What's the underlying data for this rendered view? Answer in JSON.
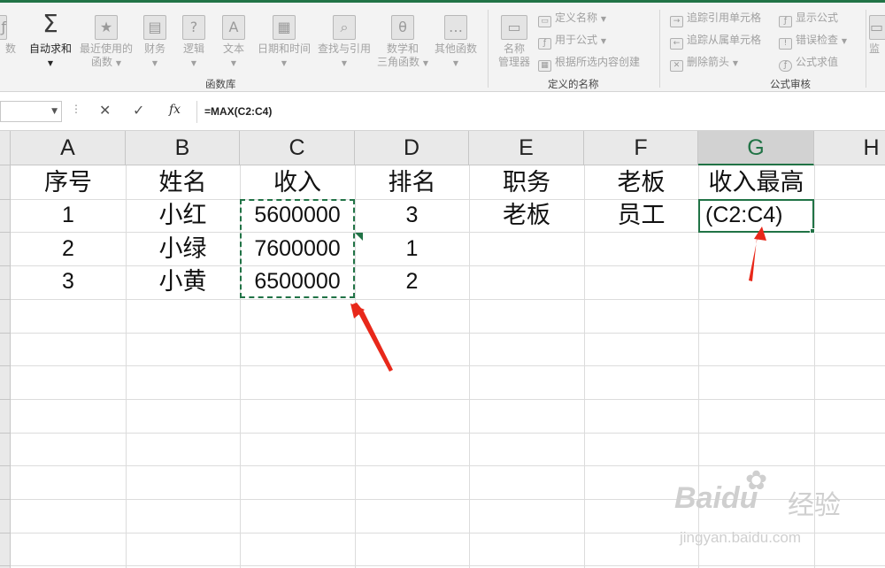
{
  "ribbon": {
    "partial_left_label": "数",
    "buttons": [
      {
        "label": "自动求和",
        "sub": "",
        "icon": "autosum-icon",
        "glyph": "Σ"
      },
      {
        "label": "最近使用的",
        "sub": "函数",
        "icon": "recent-functions-icon",
        "glyph": "★"
      },
      {
        "label": "财务",
        "sub": "",
        "icon": "financial-icon",
        "glyph": "▤"
      },
      {
        "label": "逻辑",
        "sub": "",
        "icon": "logical-icon",
        "glyph": "?"
      },
      {
        "label": "文本",
        "sub": "",
        "icon": "text-function-icon",
        "glyph": "A"
      },
      {
        "label": "日期和时间",
        "sub": "",
        "icon": "date-time-icon",
        "glyph": "▦"
      },
      {
        "label": "查找与引用",
        "sub": "",
        "icon": "lookup-reference-icon",
        "glyph": "⌕"
      },
      {
        "label": "数学和",
        "sub": "三角函数",
        "icon": "math-trig-icon",
        "glyph": "θ"
      },
      {
        "label": "其他函数",
        "sub": "",
        "icon": "more-functions-icon",
        "glyph": "…"
      }
    ],
    "group_function_library": "函数库",
    "name_manager": {
      "label": "名称",
      "sub": "管理器"
    },
    "defined_names": {
      "define_name": "定义名称",
      "use_in_formula": "用于公式",
      "create_from_selection": "根据所选内容创建",
      "group": "定义的名称"
    },
    "auditing": {
      "trace_precedents": "追踪引用单元格",
      "trace_dependents": "追踪从属单元格",
      "remove_arrows": "删除箭头",
      "show_formulas": "显示公式",
      "error_checking": "错误检查",
      "evaluate_formula": "公式求值",
      "group": "公式审核"
    },
    "partial_right_label": "监"
  },
  "formula_bar": {
    "cancel_glyph": "✕",
    "enter_glyph": "✓",
    "fx_label": "fx",
    "formula": "=MAX(C2:C4)"
  },
  "columns": [
    "A",
    "B",
    "C",
    "D",
    "E",
    "F",
    "G",
    "H"
  ],
  "selected_column": "G",
  "rows": [
    [
      "序号",
      "姓名",
      "收入",
      "排名",
      "职务",
      "老板",
      "收入最高"
    ],
    [
      "1",
      "小红",
      "5600000",
      "3",
      "老板",
      "员工",
      "(C2:C4)"
    ],
    [
      "2",
      "小绿",
      "7600000",
      "1",
      "",
      "",
      ""
    ],
    [
      "3",
      "小黄",
      "6500000",
      "2",
      "",
      "",
      ""
    ]
  ],
  "watermark": {
    "brand": "Baidu",
    "suffix": "经验",
    "url": "jingyan.baidu.com"
  }
}
